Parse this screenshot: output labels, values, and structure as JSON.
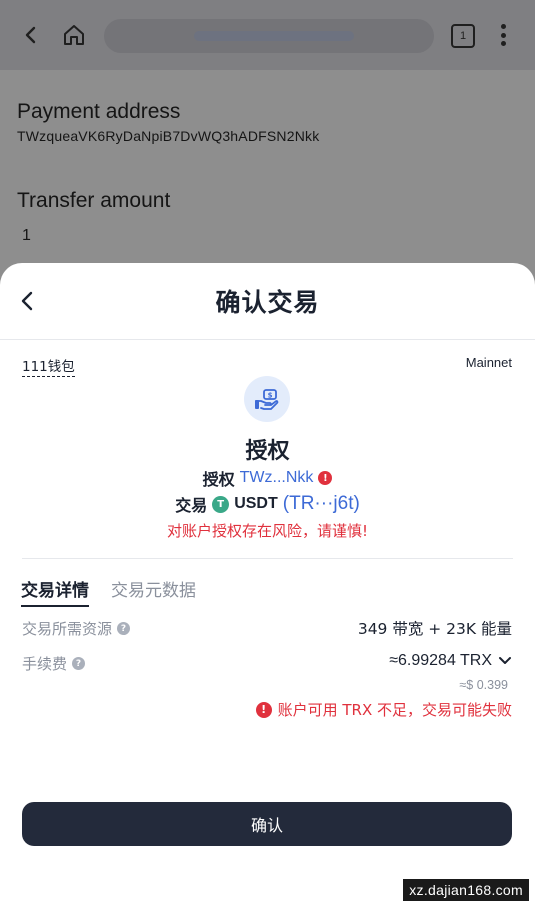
{
  "browser": {
    "tab_count": "1"
  },
  "background_page": {
    "payment_address_label": "Payment address",
    "payment_address_value": "TWzqueaVK6RyDaNpiB7DvWQ3hADFSN2Nkk",
    "transfer_amount_label": "Transfer amount",
    "transfer_amount_value": "1"
  },
  "sheet": {
    "title": "确认交易",
    "wallet_name": "111钱包",
    "network": "Mainnet",
    "action_title": "授权",
    "authorize_label": "授权",
    "authorize_address": "TWz...Nkk",
    "trade_label": "交易",
    "token_symbol": "USDT",
    "token_address": "(TR···j6t)",
    "risk_warning": "对账户授权存在风险，请谨慎!",
    "tabs": [
      {
        "label": "交易详情",
        "active": true
      },
      {
        "label": "交易元数据",
        "active": false
      }
    ],
    "details": {
      "resources_label": "交易所需资源",
      "resources_value": "349 带宽 + 23K 能量",
      "fee_label": "手续费",
      "fee_value": "≈6.99284 TRX",
      "fee_usd": "≈$ 0.399",
      "insufficient_warning": "账户可用 TRX 不足，交易可能失败"
    },
    "confirm_label": "确认"
  },
  "watermark": "xz.dajian168.com",
  "colors": {
    "primary_dark": "#232a3b",
    "danger": "#e0313d",
    "link": "#3d6ad6",
    "tether": "#3aa888"
  }
}
